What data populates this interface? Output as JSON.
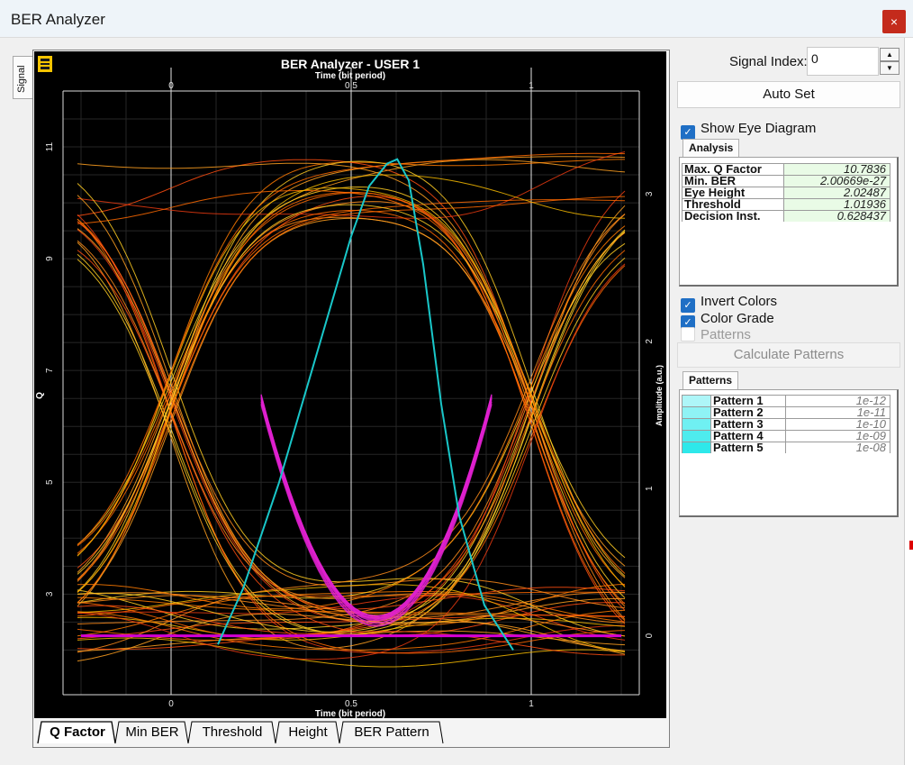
{
  "window": {
    "title": "BER Analyzer",
    "close_glyph": "×"
  },
  "side_tab": {
    "label": "Signal"
  },
  "chart": {
    "title": "BER Analyzer - USER 1",
    "x_label_top": "Time (bit period)",
    "x_label_bottom": "Time (bit period)",
    "y_left_label": "Q",
    "y_right_label": "Amplitude (a.u.)",
    "x_ticks": [
      "0",
      "0.5",
      "1"
    ],
    "q_ticks": [
      "11",
      "9",
      "7",
      "5",
      "3"
    ],
    "amp_ticks": [
      "3",
      "2",
      "1",
      "0"
    ],
    "icon": "chart-settings-icon"
  },
  "chart_data": {
    "type": "line",
    "title": "BER Analyzer - USER 1",
    "xlabel": "Time (bit period)",
    "ylabel": "Q",
    "y2label": "Amplitude (a.u.)",
    "xlim": [
      -0.3,
      1.3
    ],
    "ylim": [
      1.2,
      12.0
    ],
    "y2lim": [
      -0.4,
      3.7
    ],
    "x_ticks": [
      0,
      0.5,
      1
    ],
    "q_ticks": [
      3,
      5,
      7,
      9,
      11
    ],
    "amp_ticks": [
      0,
      1,
      2,
      3
    ],
    "grid": true,
    "series": [
      {
        "name": "Q Factor",
        "axis": "left",
        "color": "#19c7c9",
        "x": [
          0.13,
          0.2,
          0.3,
          0.4,
          0.5,
          0.55,
          0.6,
          0.628,
          0.66,
          0.7,
          0.75,
          0.8,
          0.87,
          0.95
        ],
        "y": [
          2.1,
          3.1,
          5.0,
          7.2,
          9.4,
          10.3,
          10.7,
          10.78,
          10.4,
          8.9,
          6.4,
          4.4,
          2.8,
          2.0
        ]
      },
      {
        "name": "Eye Diagram",
        "axis": "right",
        "color": "#f07818",
        "x": [
          -0.25,
          0.0,
          0.25,
          0.5,
          0.75,
          1.0,
          1.25
        ],
        "y_one_level": 3.05,
        "y_zero_level": 0.1,
        "crossing_x": [
          0.0,
          1.0
        ],
        "crossing_y": 1.45
      },
      {
        "name": "Threshold",
        "axis": "right",
        "color": "#d400d4",
        "x": [
          -0.25,
          1.25
        ],
        "y": [
          0.0,
          0.0
        ]
      }
    ]
  },
  "bottom_tabs": [
    "Q Factor",
    "Min BER",
    "Threshold",
    "Height",
    "BER Pattern"
  ],
  "panel": {
    "signal_index_label": "Signal Index:",
    "signal_index_value": "0",
    "spin_up": "▲",
    "spin_down": "▼",
    "auto_set": "Auto Set",
    "show_eye": "Show Eye Diagram",
    "analysis_tab": "Analysis",
    "analysis": [
      {
        "name": "Max. Q Factor",
        "value": "10.7836"
      },
      {
        "name": "Min. BER",
        "value": "2.00669e-27"
      },
      {
        "name": "Eye Height",
        "value": "2.02487"
      },
      {
        "name": "Threshold",
        "value": "1.01936"
      },
      {
        "name": "Decision Inst.",
        "value": "0.628437"
      }
    ],
    "invert_colors": "Invert Colors",
    "color_grade": "Color Grade",
    "patterns_check": "Patterns",
    "calc_patterns": "Calculate Patterns",
    "patterns_tab": "Patterns",
    "patterns": [
      {
        "name": "Pattern 1",
        "value": "1e-12",
        "color": "#aef6f8"
      },
      {
        "name": "Pattern 2",
        "value": "1e-11",
        "color": "#8ff3f5"
      },
      {
        "name": "Pattern 3",
        "value": "1e-10",
        "color": "#6ff0f2"
      },
      {
        "name": "Pattern 4",
        "value": "1e-09",
        "color": "#4eecee"
      },
      {
        "name": "Pattern 5",
        "value": "1e-08",
        "color": "#2ee8ea"
      }
    ]
  }
}
